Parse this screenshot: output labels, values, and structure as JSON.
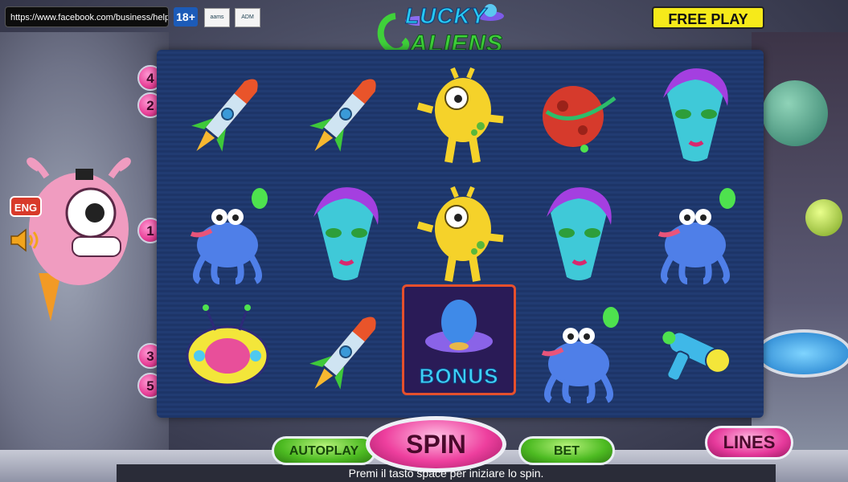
{
  "topbar": {
    "url": "https://www.facebook.com/business/help/support",
    "age_badge": "18+",
    "logo1": "aams",
    "logo2": "ADM",
    "free_play": "FREE PLAY"
  },
  "title": {
    "line1": "LUCKY",
    "line2": "ALIENS"
  },
  "language": "ENG",
  "paylines_left": [
    "4",
    "2",
    "1",
    "3",
    "5"
  ],
  "reels": [
    [
      "rocket",
      "blue-octopus-alien",
      "ufo-pod"
    ],
    [
      "rocket",
      "female-alien",
      "rocket"
    ],
    [
      "yellow-alien",
      "yellow-alien",
      "bonus"
    ],
    [
      "red-planet",
      "female-alien",
      "blue-octopus-alien"
    ],
    [
      "female-alien",
      "blue-octopus-alien",
      "ray-gun"
    ]
  ],
  "bonus_label": "BONUS",
  "controls": {
    "autoplay": "AUTOPLAY",
    "spin": "SPIN",
    "bet": "BET",
    "lines": "LINES"
  },
  "status": "Premi il tasto space per iniziare lo spin."
}
